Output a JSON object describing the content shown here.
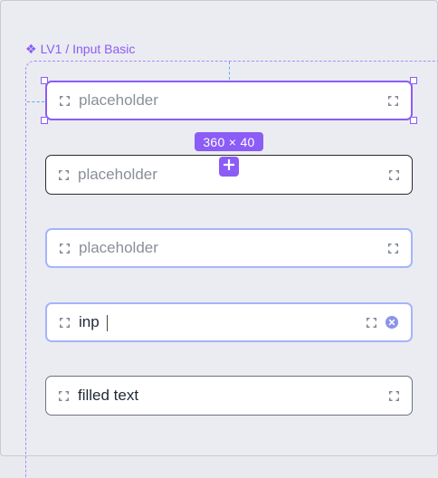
{
  "component": {
    "label": "LV1 / Input Basic",
    "icon": "component-diamond-icon"
  },
  "selection": {
    "size_label": "360 × 40",
    "add_icon": "plus-icon"
  },
  "inputs": [
    {
      "state": "selected",
      "text": "placeholder",
      "kind": "placeholder"
    },
    {
      "state": "default",
      "text": "placeholder",
      "kind": "placeholder"
    },
    {
      "state": "hover",
      "text": "placeholder",
      "kind": "placeholder"
    },
    {
      "state": "typing",
      "text": "inp",
      "kind": "value"
    },
    {
      "state": "filled",
      "text": "filled text",
      "kind": "value"
    }
  ],
  "colors": {
    "accent": "#8b5cf6",
    "focus_border": "#a5b4fc",
    "guide": "#60a5fa",
    "placeholder": "#8a8f98",
    "clear_icon": "#8b93e8"
  }
}
